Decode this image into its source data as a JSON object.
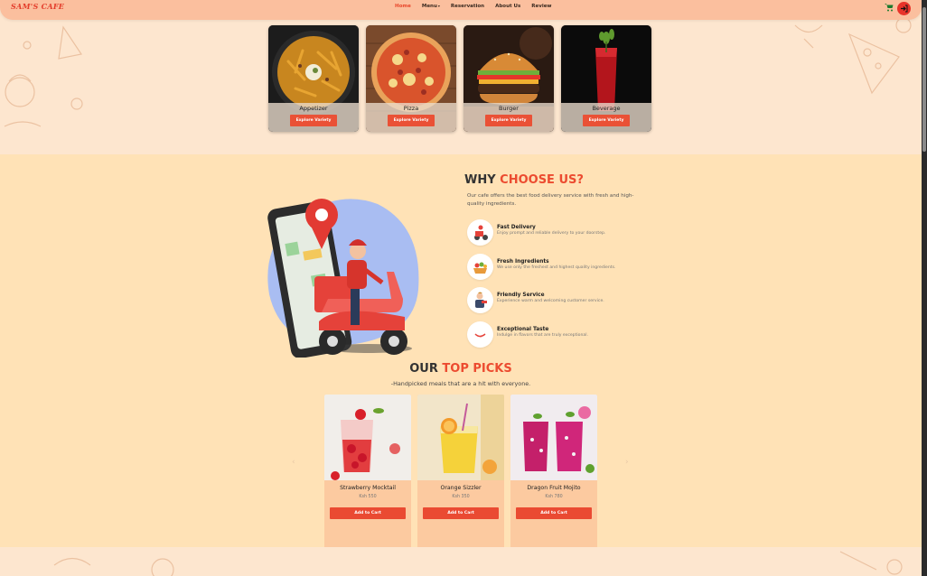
{
  "nav": {
    "logo": "SAM'S CAFE",
    "links": [
      {
        "label": "Home",
        "active": true
      },
      {
        "label": "Menu",
        "dropdown": true
      },
      {
        "label": "Reservation"
      },
      {
        "label": "About Us"
      },
      {
        "label": "Review"
      }
    ],
    "icons": {
      "cart": "cart-icon",
      "login": "login-icon"
    },
    "colors": {
      "bar": "#fbbf9e",
      "accent": "#e8462a"
    }
  },
  "categories": [
    {
      "name": "Appetizer",
      "button": "Explore Variety"
    },
    {
      "name": "Pizza",
      "button": "Explore Variety"
    },
    {
      "name": "Burger",
      "button": "Explore Variety"
    },
    {
      "name": "Beverage",
      "button": "Explore Variety"
    }
  ],
  "why": {
    "title_prefix": "WHY ",
    "title_accent": "CHOOSE US?",
    "description": "Our cafe offers the best food delivery service with fresh and high-quality ingredients.",
    "features": [
      {
        "title": "Fast Delivery",
        "text": "Enjoy prompt and reliable delivery to your doorstep.",
        "icon": "delivery-icon"
      },
      {
        "title": "Fresh Ingredients",
        "text": "We use only the freshest and highest quality ingredients.",
        "icon": "fresh-ingredients-icon"
      },
      {
        "title": "Friendly Service",
        "text": "Experience warm and welcoming customer service.",
        "icon": "friendly-service-icon"
      },
      {
        "title": "Exceptional Taste",
        "text": "Indulge in flavors that are truly exceptional.",
        "icon": "taste-icon"
      }
    ]
  },
  "picks": {
    "title_prefix": "OUR ",
    "title_accent": "TOP PICKS",
    "subtitle": "-Handpicked meals that are a hit with everyone.",
    "products": [
      {
        "name": "Strawberry Mocktail",
        "price": "Ksh 550",
        "button": "Add to Cart"
      },
      {
        "name": "Orange Sizzler",
        "price": "Ksh 350",
        "button": "Add to Cart"
      },
      {
        "name": "Dragon Fruit Mojito",
        "price": "Ksh 780",
        "button": "Add to Cart"
      }
    ]
  },
  "colors": {
    "background": "#fde6cf",
    "section": "#ffe2b6",
    "accent": "#ec4b30"
  }
}
